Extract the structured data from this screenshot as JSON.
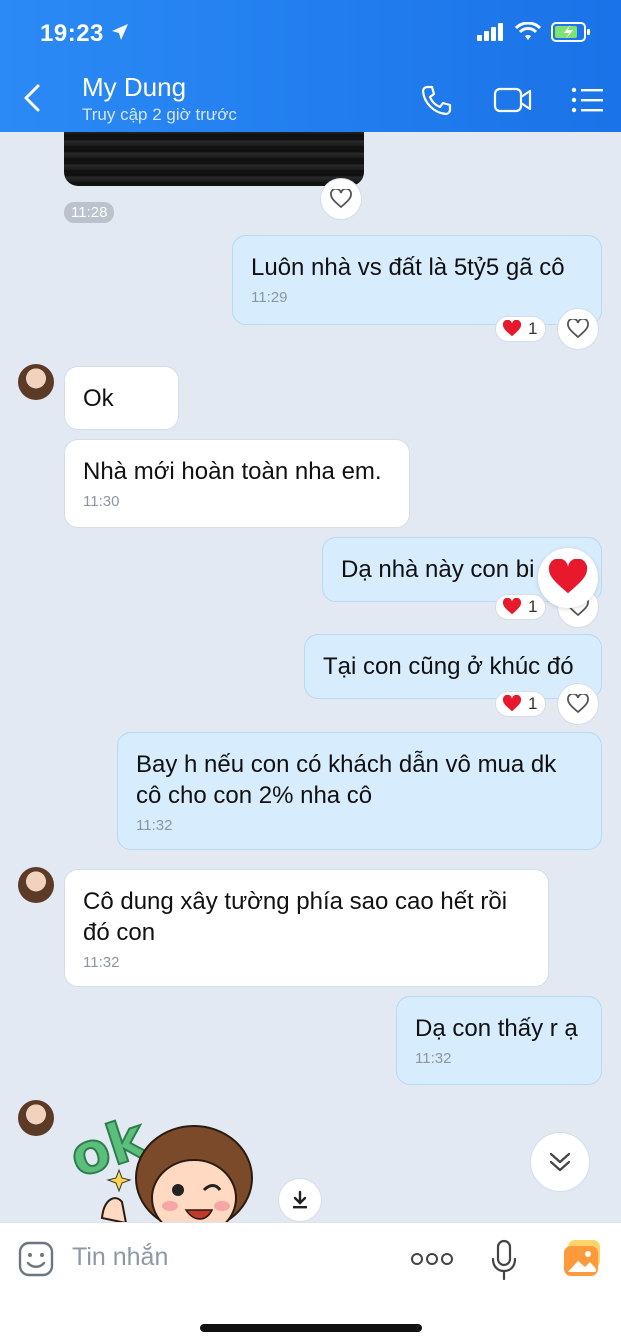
{
  "status_bar": {
    "time": "19:23"
  },
  "header": {
    "contact_name": "My Dung",
    "last_seen": "Truy cập 2 giờ trước"
  },
  "messages": {
    "media_time": "11:28",
    "m1": {
      "text": "Luôn nhà vs đất là 5tỷ5 gã cô",
      "time": "11:29",
      "reaction_count": "1"
    },
    "m2": {
      "text": "Ok"
    },
    "m3": {
      "text": "Nhà mới hoàn toàn nha em.",
      "time": "11:30"
    },
    "m4": {
      "text": "Dạ nhà này con bi",
      "reaction_count": "1"
    },
    "m5": {
      "text": "Tại con cũng ở khúc đó",
      "reaction_count": "1"
    },
    "m6": {
      "line1": "Bay h nếu con có khách dẫn vô mua dk",
      "line2": "cô cho con 2% nha cô",
      "time": "11:32"
    },
    "m7": {
      "line1": "Cô dung xây tường phía sao cao hết rồi",
      "line2": "đó con",
      "time": "11:32"
    },
    "m8": {
      "text": "Dạ con thấy r ạ",
      "time": "11:32"
    },
    "sticker_text": "ok"
  },
  "input": {
    "placeholder": "Tin nhắn"
  },
  "colors": {
    "header": "#1a73e8",
    "outgoing": "#d7ecfd",
    "heart": "#e8192c"
  }
}
